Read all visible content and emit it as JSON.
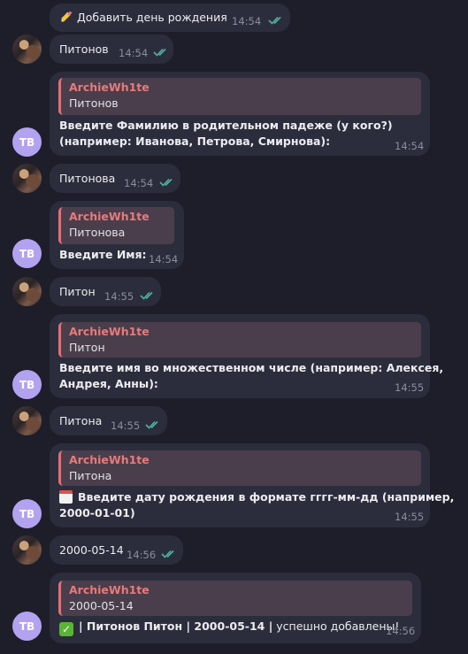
{
  "colors": {
    "background": "#1e1e2a",
    "bubble": "#2c2d3c",
    "quote_name": "#e87a7a",
    "check": "#4fb3a0",
    "avatar_tv": "#b3a2f0"
  },
  "avatar_initials": "ТВ",
  "messages": [
    {
      "text": "Добавить день рождения",
      "time": "14:54",
      "icon": "pencil-icon"
    },
    {
      "text": "Питонов",
      "time": "14:54"
    },
    {
      "quote_name": "ArchieWh1te",
      "quote_text": "Питонов",
      "line1": "Введите Фамилию в родительном падеже (у кого?)",
      "line2": "(например: Иванова, Петрова, Смирнова):",
      "time": "14:54"
    },
    {
      "text": "Питонова",
      "time": "14:54"
    },
    {
      "quote_name": "ArchieWh1te",
      "quote_text": "Питонова",
      "line1": "Введите Имя:",
      "time": "14:54"
    },
    {
      "text": "Питон",
      "time": "14:55"
    },
    {
      "quote_name": "ArchieWh1te",
      "quote_text": "Питон",
      "line1": "Введите имя во множественном числе (например: Алексея,",
      "line2": "Андрея, Анны):",
      "time": "14:55"
    },
    {
      "text": "Питона",
      "time": "14:55"
    },
    {
      "quote_name": "ArchieWh1te",
      "quote_text": "Питона",
      "line1": "Введите дату рождения в формате гггг-мм-дд (например,",
      "line2": "2000-01-01)",
      "time": "14:55",
      "icon": "calendar-icon"
    },
    {
      "text": "2000-05-14",
      "time": "14:56"
    },
    {
      "quote_name": "ArchieWh1te",
      "quote_text": "2000-05-14",
      "line1_bold": "| Питонов Питон | 2000-05-14 |",
      "line1_rest": " успешно добавлены!",
      "time": "14:56",
      "icon": "check-mark-icon"
    }
  ]
}
